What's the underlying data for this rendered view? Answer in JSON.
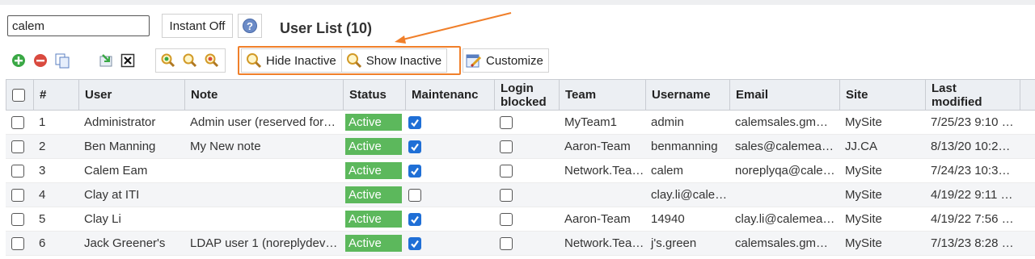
{
  "search": {
    "value": "calem"
  },
  "instant_label": "Instant Off",
  "title": "User List (10)",
  "toolbar": {
    "hide_inactive": "Hide Inactive",
    "show_inactive": "Show Inactive",
    "customize": "Customize"
  },
  "columns": {
    "num": "#",
    "user": "User",
    "note": "Note",
    "status": "Status",
    "maint": "Maintenanc",
    "login1": "Login",
    "login2": "blocked",
    "team": "Team",
    "username": "Username",
    "email": "Email",
    "site": "Site",
    "mod1": "Last",
    "mod2": "modified"
  },
  "rows": [
    {
      "num": "1",
      "user": "Administrator",
      "note": "Admin user (reserved for…",
      "status": "Active",
      "maint": true,
      "login": false,
      "team": "MyTeam1",
      "username": "admin",
      "email": "calemsales.gm…",
      "site": "MySite",
      "modified": "7/25/23 9:10 …"
    },
    {
      "num": "2",
      "user": "Ben Manning",
      "note": "My New note",
      "status": "Active",
      "maint": true,
      "login": false,
      "team": "Aaron-Team",
      "username": "benmanning",
      "email": "sales@calemea…",
      "site": "JJ.CA",
      "modified": "8/13/20 10:2…"
    },
    {
      "num": "3",
      "user": "Calem Eam",
      "note": "",
      "status": "Active",
      "maint": true,
      "login": false,
      "team": "Network.Tea…",
      "username": "calem",
      "email": "noreplyqa@cale…",
      "site": "MySite",
      "modified": "7/24/23 10:3…"
    },
    {
      "num": "4",
      "user": "Clay at ITI",
      "note": "",
      "status": "Active",
      "maint": false,
      "login": false,
      "team": "",
      "username": "clay.li@cale…",
      "email": "",
      "site": "MySite",
      "modified": "4/19/22 9:11 …"
    },
    {
      "num": "5",
      "user": "Clay Li",
      "note": "",
      "status": "Active",
      "maint": true,
      "login": false,
      "team": "Aaron-Team",
      "username": "14940",
      "email": "clay.li@calemea…",
      "site": "MySite",
      "modified": "4/19/22 7:56 …"
    },
    {
      "num": "6",
      "user": "Jack Greener's",
      "note": "LDAP user 1 (noreplydev…",
      "status": "Active",
      "maint": true,
      "login": false,
      "team": "Network.Tea…",
      "username": "j's.green",
      "email": "calemsales.gm…",
      "site": "MySite",
      "modified": "7/13/23 8:28 …"
    }
  ],
  "colors": {
    "active": "#5cb85c",
    "check": "#1f6fd6",
    "highlight": "#f07f2a"
  },
  "icons": [
    "add-icon",
    "delete-icon",
    "copy-icon",
    "export-icon",
    "close-icon",
    "search-icon",
    "search-icon",
    "search-icon",
    "search-icon",
    "search-icon",
    "customize-icon"
  ]
}
